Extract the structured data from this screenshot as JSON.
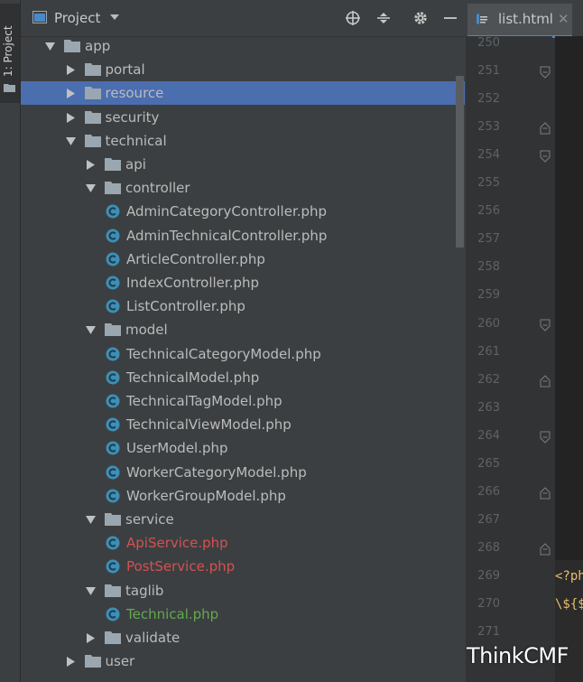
{
  "sidebar_strip": {
    "label": "1: Project"
  },
  "project_panel": {
    "title": "Project"
  },
  "tree": [
    {
      "label": "app",
      "depth": 0,
      "type": "folder",
      "state": "open"
    },
    {
      "label": "portal",
      "depth": 1,
      "type": "folder",
      "state": "closed"
    },
    {
      "label": "resource",
      "depth": 1,
      "type": "folder",
      "state": "closed",
      "selected": true
    },
    {
      "label": "security",
      "depth": 1,
      "type": "folder",
      "state": "closed"
    },
    {
      "label": "technical",
      "depth": 1,
      "type": "folder",
      "state": "open"
    },
    {
      "label": "api",
      "depth": 2,
      "type": "folder",
      "state": "closed"
    },
    {
      "label": "controller",
      "depth": 2,
      "type": "folder",
      "state": "open"
    },
    {
      "label": "AdminCategoryController.php",
      "depth": 3,
      "type": "class"
    },
    {
      "label": "AdminTechnicalController.php",
      "depth": 3,
      "type": "class"
    },
    {
      "label": "ArticleController.php",
      "depth": 3,
      "type": "class"
    },
    {
      "label": "IndexController.php",
      "depth": 3,
      "type": "class"
    },
    {
      "label": "ListController.php",
      "depth": 3,
      "type": "class"
    },
    {
      "label": "model",
      "depth": 2,
      "type": "folder",
      "state": "open"
    },
    {
      "label": "TechnicalCategoryModel.php",
      "depth": 3,
      "type": "class"
    },
    {
      "label": "TechnicalModel.php",
      "depth": 3,
      "type": "class"
    },
    {
      "label": "TechnicalTagModel.php",
      "depth": 3,
      "type": "class"
    },
    {
      "label": "TechnicalViewModel.php",
      "depth": 3,
      "type": "class"
    },
    {
      "label": "UserModel.php",
      "depth": 3,
      "type": "class"
    },
    {
      "label": "WorkerCategoryModel.php",
      "depth": 3,
      "type": "class"
    },
    {
      "label": "WorkerGroupModel.php",
      "depth": 3,
      "type": "class"
    },
    {
      "label": "service",
      "depth": 2,
      "type": "folder",
      "state": "open"
    },
    {
      "label": "ApiService.php",
      "depth": 3,
      "type": "class",
      "status": "red"
    },
    {
      "label": "PostService.php",
      "depth": 3,
      "type": "class",
      "status": "red"
    },
    {
      "label": "taglib",
      "depth": 2,
      "type": "folder",
      "state": "open"
    },
    {
      "label": "Technical.php",
      "depth": 3,
      "type": "class",
      "status": "green"
    },
    {
      "label": "validate",
      "depth": 2,
      "type": "folder",
      "state": "closed"
    },
    {
      "label": "user",
      "depth": 1,
      "type": "folder",
      "state": "closed"
    }
  ],
  "editor": {
    "tab_label": "list.html",
    "tab_close": "✕",
    "line_numbers": [
      "250",
      "251",
      "252",
      "253",
      "254",
      "255",
      "256",
      "257",
      "258",
      "259",
      "260",
      "261",
      "262",
      "263",
      "264",
      "265",
      "266",
      "267",
      "268",
      "269",
      "270",
      "271"
    ],
    "code_lines": [
      {
        "line": "269",
        "text": "<?ph"
      },
      {
        "line": "270",
        "text": "\\${$"
      }
    ]
  },
  "watermark": "ThinkCMF",
  "colors": {
    "panel_bg": "#3c3f41",
    "selection": "#4b6eaf",
    "class_icon": "#3d8fb5",
    "modified_red": "#d25252",
    "added_green": "#62a850",
    "tab_underline": "#4a88c7"
  }
}
